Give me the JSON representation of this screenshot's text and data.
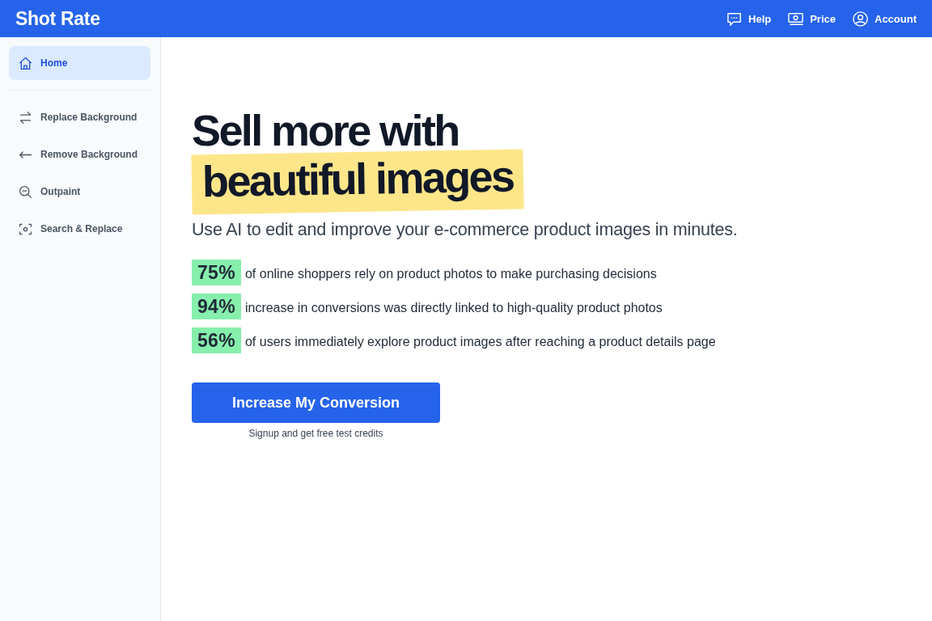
{
  "header": {
    "logo": "Shot Rate",
    "links": [
      {
        "label": "Help"
      },
      {
        "label": "Price"
      },
      {
        "label": "Account"
      }
    ]
  },
  "sidebar": {
    "items": [
      {
        "label": "Home",
        "selected": true
      },
      {
        "label": "Replace Background",
        "selected": false
      },
      {
        "label": "Remove Background",
        "selected": false
      },
      {
        "label": "Outpaint",
        "selected": false
      },
      {
        "label": "Search & Replace",
        "selected": false
      }
    ]
  },
  "hero": {
    "headline": "Sell more with",
    "highlight": "beautiful images",
    "subtitle": "Use AI to edit and improve your e-commerce product images in minutes.",
    "stats": [
      {
        "value": "75%",
        "text": "of online shoppers rely on product photos to make purchasing decisions"
      },
      {
        "value": "94%",
        "text": "increase in conversions was directly linked to high-quality product photos"
      },
      {
        "value": "56%",
        "text": "of users immediately explore product images after reaching a product details page"
      }
    ],
    "button": "Increase My Conversion",
    "note": "Signup and get free test credits"
  }
}
